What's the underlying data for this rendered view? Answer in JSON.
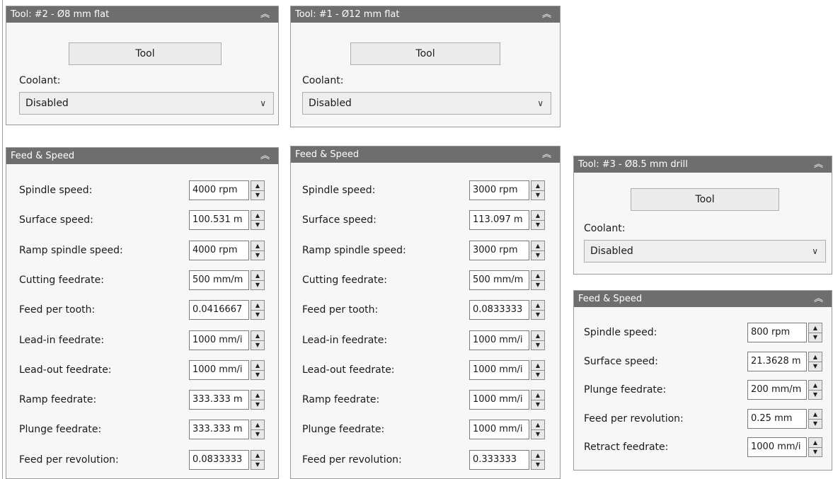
{
  "panels": {
    "tool2": {
      "title": "Tool: #2 - Ø8 mm flat",
      "tool_button": "Tool",
      "coolant_label": "Coolant:",
      "coolant_value": "Disabled"
    },
    "tool1": {
      "title": "Tool: #1 - Ø12 mm flat",
      "tool_button": "Tool",
      "coolant_label": "Coolant:",
      "coolant_value": "Disabled"
    },
    "tool3": {
      "title": "Tool: #3 - Ø8.5 mm drill",
      "tool_button": "Tool",
      "coolant_label": "Coolant:",
      "coolant_value": "Disabled"
    },
    "fs_a": {
      "title": "Feed & Speed",
      "rows": [
        {
          "label": "Spindle speed:",
          "value": "4000 rpm"
        },
        {
          "label": "Surface speed:",
          "value": "100.531 m"
        },
        {
          "label": "Ramp spindle speed:",
          "value": "4000 rpm"
        },
        {
          "label": "Cutting feedrate:",
          "value": "500 mm/m"
        },
        {
          "label": "Feed per tooth:",
          "value": "0.0416667"
        },
        {
          "label": "Lead-in feedrate:",
          "value": "1000 mm/i"
        },
        {
          "label": "Lead-out feedrate:",
          "value": "1000 mm/i"
        },
        {
          "label": "Ramp feedrate:",
          "value": "333.333 m"
        },
        {
          "label": "Plunge feedrate:",
          "value": "333.333 m"
        },
        {
          "label": "Feed per revolution:",
          "value": "0.0833333"
        }
      ]
    },
    "fs_b": {
      "title": "Feed & Speed",
      "rows": [
        {
          "label": "Spindle speed:",
          "value": "3000 rpm"
        },
        {
          "label": "Surface speed:",
          "value": "113.097 m"
        },
        {
          "label": "Ramp spindle speed:",
          "value": "3000 rpm"
        },
        {
          "label": "Cutting feedrate:",
          "value": "500 mm/m"
        },
        {
          "label": "Feed per tooth:",
          "value": "0.0833333"
        },
        {
          "label": "Lead-in feedrate:",
          "value": "1000 mm/i"
        },
        {
          "label": "Lead-out feedrate:",
          "value": "1000 mm/i"
        },
        {
          "label": "Ramp feedrate:",
          "value": "1000 mm/i"
        },
        {
          "label": "Plunge feedrate:",
          "value": "1000 mm/i"
        },
        {
          "label": "Feed per revolution:",
          "value": "0.333333"
        }
      ]
    },
    "fs_c": {
      "title": "Feed & Speed",
      "rows": [
        {
          "label": "Spindle speed:",
          "value": "800 rpm"
        },
        {
          "label": "Surface speed:",
          "value": "21.3628 m"
        },
        {
          "label": "Plunge feedrate:",
          "value": "200 mm/m"
        },
        {
          "label": "Feed per revolution:",
          "value": "0.25 mm"
        },
        {
          "label": "Retract feedrate:",
          "value": "1000 mm/i"
        }
      ]
    }
  },
  "icons": {
    "collapse": "double-chevron-up",
    "dropdown": "chevron-down",
    "spin_up": "triangle-up",
    "spin_down": "triangle-down"
  },
  "colors": {
    "header_bg": "#6e6e6e",
    "header_text": "#ffffff",
    "panel_bg": "#f7f7f7"
  }
}
